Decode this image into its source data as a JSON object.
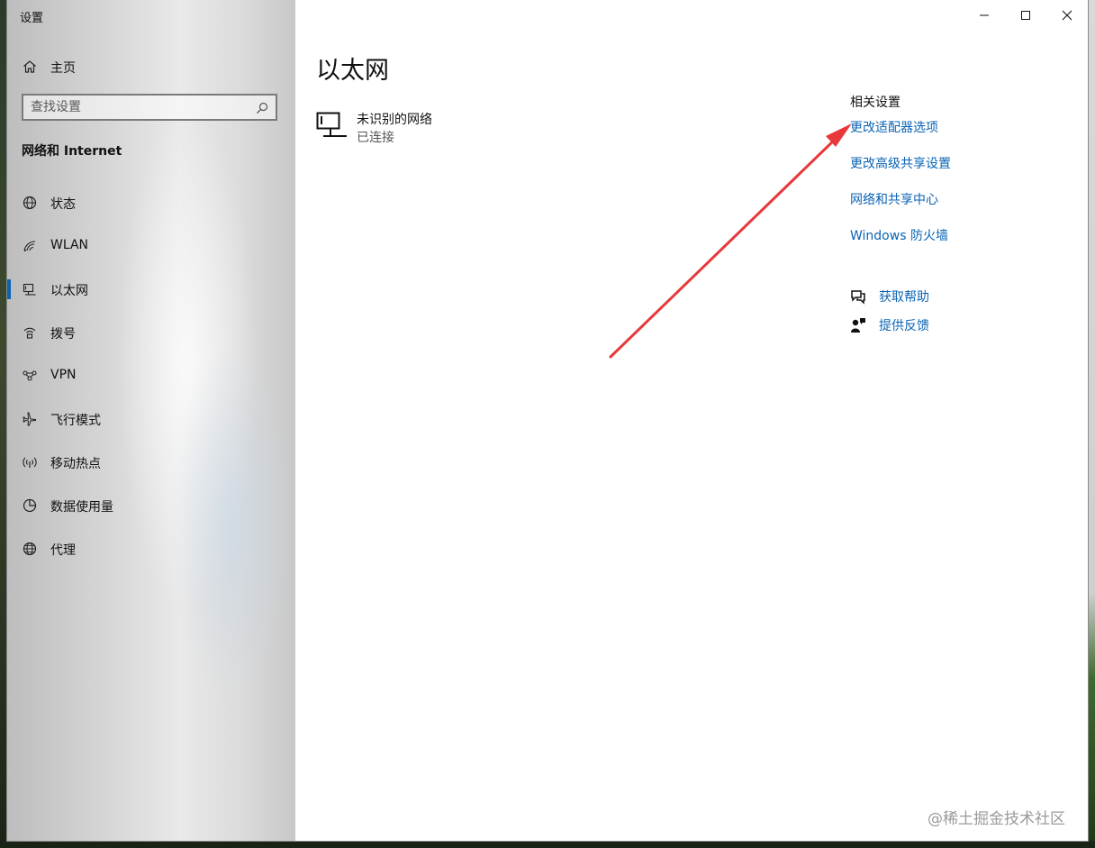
{
  "window": {
    "app_title": "设置",
    "controls": {
      "minimize_icon": "minimize-icon",
      "maximize_icon": "maximize-icon",
      "close_icon": "close-icon"
    }
  },
  "sidebar": {
    "home": {
      "label": "主页",
      "icon": "home-icon"
    },
    "search": {
      "placeholder": "查找设置",
      "icon": "search-icon"
    },
    "section_title": "网络和 Internet",
    "items": [
      {
        "label": "状态",
        "icon": "globe-status-icon",
        "active": false
      },
      {
        "label": "WLAN",
        "icon": "wifi-icon",
        "active": false
      },
      {
        "label": "以太网",
        "icon": "ethernet-icon",
        "active": true
      },
      {
        "label": "拨号",
        "icon": "dialup-icon",
        "active": false
      },
      {
        "label": "VPN",
        "icon": "vpn-icon",
        "active": false
      },
      {
        "label": "飞行模式",
        "icon": "airplane-icon",
        "active": false
      },
      {
        "label": "移动热点",
        "icon": "hotspot-icon",
        "active": false
      },
      {
        "label": "数据使用量",
        "icon": "data-usage-icon",
        "active": false
      },
      {
        "label": "代理",
        "icon": "proxy-globe-icon",
        "active": false
      }
    ],
    "active_color": "#0a64b4"
  },
  "main": {
    "page_title": "以太网",
    "network": {
      "name": "未识别的网络",
      "status": "已连接",
      "icon": "ethernet-network-icon"
    },
    "related": {
      "title": "相关设置",
      "links": [
        "更改适配器选项",
        "更改高级共享设置",
        "网络和共享中心",
        "Windows 防火墙"
      ]
    },
    "help": {
      "get_help": {
        "label": "获取帮助",
        "icon": "chat-help-icon"
      },
      "feedback": {
        "label": "提供反馈",
        "icon": "feedback-icon"
      }
    },
    "link_color": "#0a64b4"
  },
  "annotation": {
    "arrow_color": "#e8383b"
  },
  "watermark": "@稀土掘金技术社区"
}
